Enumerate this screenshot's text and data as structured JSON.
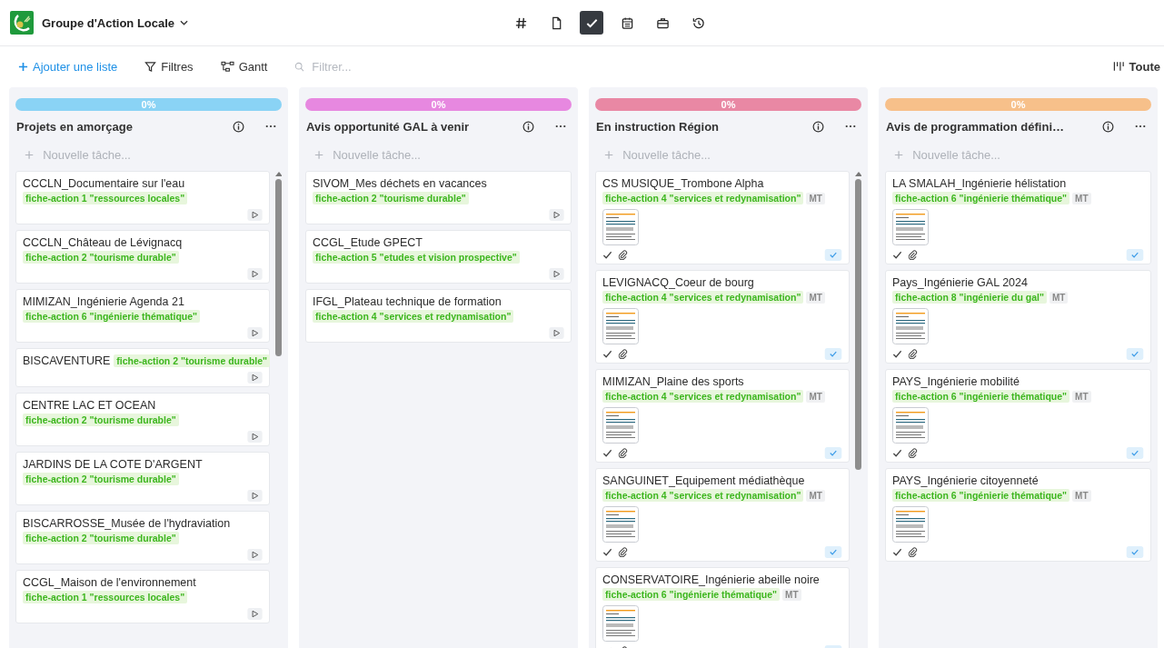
{
  "header": {
    "project_title": "Groupe d'Action Locale",
    "views": [
      {
        "kind": "hash",
        "selected": false
      },
      {
        "kind": "file",
        "selected": false
      },
      {
        "kind": "check",
        "selected": true
      },
      {
        "kind": "calendar",
        "selected": false
      },
      {
        "kind": "briefcase",
        "selected": false
      },
      {
        "kind": "history",
        "selected": false
      }
    ]
  },
  "toolbar": {
    "add_list": "Ajouter une liste",
    "filters": "Filtres",
    "gantt": "Gantt",
    "search": {
      "placeholder": "Filtrer..."
    },
    "right_button": "Toute"
  },
  "columns": [
    {
      "title": "Projets en amorçage",
      "color": "#8ad3f5",
      "level": 0,
      "progress": "0%",
      "new_task": {
        "placeholder": "Nouvelle tâche..."
      },
      "scrollable": true,
      "cards": [
        {
          "kind": "task",
          "title": "CCCLN_Documentaire sur l'eau",
          "tag": "fiche-action 1 \"ressources locales\""
        },
        {
          "kind": "task",
          "title": "CCCLN_Château de Lévignacq",
          "tag": "fiche-action 2 \"tourisme durable\""
        },
        {
          "kind": "task",
          "title": "MIMIZAN_Ingénierie Agenda 21",
          "tag": "fiche-action 6 \"ingénierie thématique\""
        },
        {
          "kind": "task-inline",
          "title": "BISCAVENTURE",
          "tag": "fiche-action 2 \"tourisme durable\""
        },
        {
          "kind": "task",
          "title": "CENTRE LAC ET OCEAN",
          "tag": "fiche-action 2 \"tourisme durable\""
        },
        {
          "kind": "task",
          "title": "JARDINS DE LA COTE D'ARGENT",
          "tag": "fiche-action 2 \"tourisme durable\""
        },
        {
          "kind": "task",
          "title": "BISCARROSSE_Musée de l'hydraviation",
          "tag": "fiche-action 2 \"tourisme durable\""
        },
        {
          "kind": "task",
          "title": "CCGL_Maison de l'environnement",
          "tag": "fiche-action 1 \"ressources locales\""
        }
      ]
    },
    {
      "title": "Avis opportunité GAL à venir",
      "color": "#e788e0",
      "level": 0,
      "progress": "0%",
      "new_task": {
        "placeholder": "Nouvelle tâche..."
      },
      "scrollable": false,
      "cards": [
        {
          "kind": "task",
          "title": "SIVOM_Mes déchets en vacances",
          "tag": "fiche-action 2 \"tourisme durable\""
        },
        {
          "kind": "task",
          "title": "CCGL_Etude GPECT",
          "tag": "fiche-action 5 \"etudes et vision prospective\""
        },
        {
          "kind": "task",
          "title": "IFGL_Plateau technique de formation",
          "tag": "fiche-action 4 \"services et redynamisation\""
        }
      ]
    },
    {
      "title": "En instruction Région",
      "color": "#e988a4",
      "level": 0,
      "progress": "0%",
      "new_task": {
        "placeholder": "Nouvelle tâche..."
      },
      "scrollable": true,
      "cards": [
        {
          "kind": "document",
          "title": "CS MUSIQUE_Trombone Alpha",
          "tag": "fiche-action 4 \"services et redynamisation\"",
          "badge": "MT"
        },
        {
          "kind": "document",
          "title": "LEVIGNACQ_Coeur de bourg",
          "tag": "fiche-action 4 \"services et redynamisation\"",
          "badge": "MT"
        },
        {
          "kind": "document",
          "title": "MIMIZAN_Plaine des sports",
          "tag": "fiche-action 4 \"services et redynamisation\"",
          "badge": "MT"
        },
        {
          "kind": "document",
          "title": "SANGUINET_Equipement médiathèque",
          "tag": "fiche-action 4 \"services et redynamisation\"",
          "badge": "MT"
        },
        {
          "kind": "document",
          "title": "CONSERVATOIRE_Ingénierie abeille noire",
          "tag": "fiche-action 6 \"ingénierie thématique\"",
          "badge": "MT"
        }
      ]
    },
    {
      "title": "Avis de programmation défini…",
      "color": "#f7c08a",
      "level": 0,
      "progress": "0%",
      "new_task": {
        "placeholder": "Nouvelle tâche..."
      },
      "scrollable": false,
      "cards": [
        {
          "kind": "document",
          "title": "LA SMALAH_Ingénierie hélistation",
          "tag": "fiche-action 6 \"ingénierie thématique\"",
          "badge": "MT"
        },
        {
          "kind": "document",
          "title": "Pays_Ingénierie GAL 2024",
          "tag": "fiche-action 8 \"ingénierie du gal\"",
          "badge": "MT"
        },
        {
          "kind": "document",
          "title": "PAYS_Ingénierie mobilité",
          "tag": "fiche-action 6 \"ingénierie thématique\"",
          "badge": "MT"
        },
        {
          "kind": "document",
          "title": "PAYS_Ingénierie citoyenneté",
          "tag": "fiche-action 6 \"ingénierie thématique\"",
          "badge": "MT"
        }
      ]
    }
  ]
}
